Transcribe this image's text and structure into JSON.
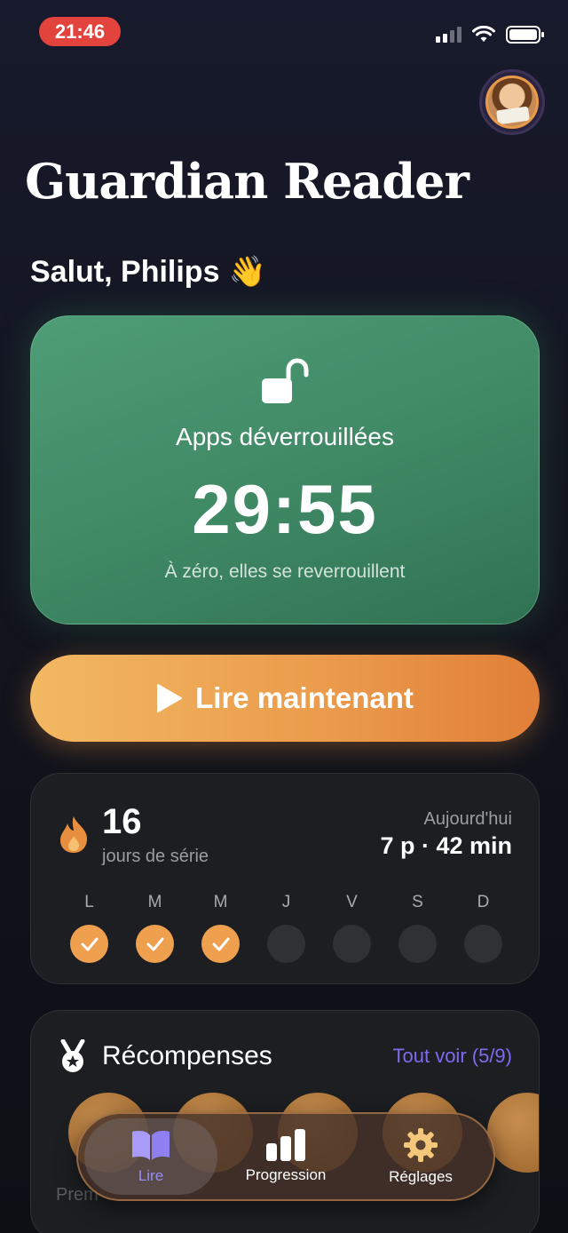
{
  "status_bar": {
    "time": "21:46"
  },
  "header": {
    "title": "Guardian Reader",
    "greeting": "Salut, Philips",
    "greeting_emoji": "👋"
  },
  "unlock": {
    "label": "Apps déverrouillées",
    "timer": "29:55",
    "subtitle": "À zéro, elles se reverrouillent",
    "icon": "unlocked-padlock-icon"
  },
  "read_button": {
    "label": "Lire maintenant",
    "icon": "play-icon"
  },
  "streak": {
    "count": "16",
    "label": "jours de série",
    "today_label": "Aujourd'hui",
    "today_value": "7 p · 42 min",
    "days": [
      {
        "letter": "L",
        "done": true
      },
      {
        "letter": "M",
        "done": true
      },
      {
        "letter": "M",
        "done": true
      },
      {
        "letter": "J",
        "done": false
      },
      {
        "letter": "V",
        "done": false
      },
      {
        "letter": "S",
        "done": false
      },
      {
        "letter": "D",
        "done": false
      }
    ]
  },
  "rewards": {
    "title": "Récompenses",
    "see_all": "Tout voir (5/9)",
    "labels_partial": "Prem"
  },
  "tabbar": {
    "tabs": [
      {
        "label": "Lire",
        "icon": "book-icon",
        "active": true
      },
      {
        "label": "Progression",
        "icon": "bar-chart-icon",
        "active": false
      },
      {
        "label": "Réglages",
        "icon": "gear-icon",
        "active": false
      }
    ]
  },
  "colors": {
    "accent_green": "#4e9d77",
    "accent_orange": "#eb9d4c",
    "accent_purple": "#7b6cf0",
    "status_red": "#e2433d"
  }
}
